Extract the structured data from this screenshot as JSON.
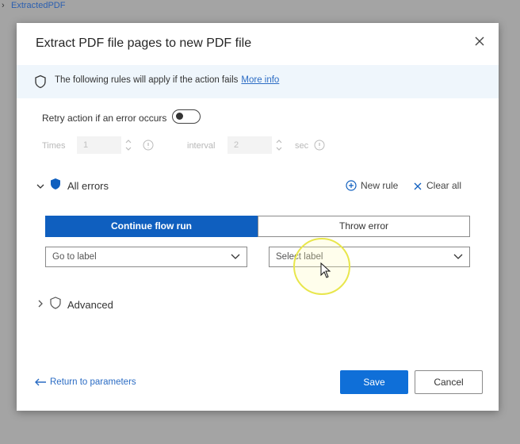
{
  "background": {
    "breadcrumb_arrow": "›",
    "breadcrumb_text": "ExtractedPDF"
  },
  "dialog": {
    "title": "Extract PDF file pages to new PDF file",
    "info_text": "The following rules will apply if the action fails",
    "info_link": "More info",
    "retry_label": "Retry action if an error occurs",
    "times_label": "Times",
    "times_value": "1",
    "interval_label": "interval",
    "interval_value": "2",
    "sec_label": "sec",
    "all_errors": "All errors",
    "new_rule": "New rule",
    "clear_all": "Clear all",
    "segment_continue": "Continue flow run",
    "segment_throw": "Throw error",
    "goto_label_value": "Go to label",
    "select_label_placeholder": "Select label",
    "advanced": "Advanced",
    "return_to_params": "Return to parameters",
    "save": "Save",
    "cancel": "Cancel"
  },
  "colors": {
    "primary": "#0f5fbf",
    "info_bar": "#eff6fc",
    "link": "#2b6cc4"
  }
}
